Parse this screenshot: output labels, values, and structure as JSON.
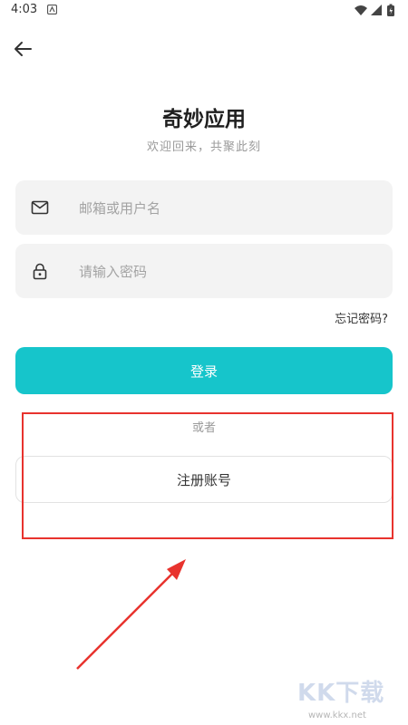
{
  "status_bar": {
    "time": "4:03"
  },
  "header": {
    "title": "奇妙应用",
    "subtitle": "欢迎回来，共聚此刻"
  },
  "form": {
    "email_placeholder": "邮箱或用户名",
    "email_value": "",
    "password_placeholder": "请输入密码",
    "password_value": "",
    "forgot_label": "忘记密码?"
  },
  "actions": {
    "login_label": "登录",
    "or_label": "或者",
    "register_label": "注册账号"
  },
  "annotation": {
    "color": "#e8332e"
  },
  "watermark": {
    "logo": "KK下载",
    "url": "www.kkx.net"
  },
  "colors": {
    "accent": "#16c5cb",
    "field_bg": "#f3f3f3"
  },
  "icons": [
    "back-arrow-icon",
    "mail-icon",
    "lock-icon",
    "wifi-icon",
    "signal-icon",
    "battery-icon"
  ]
}
